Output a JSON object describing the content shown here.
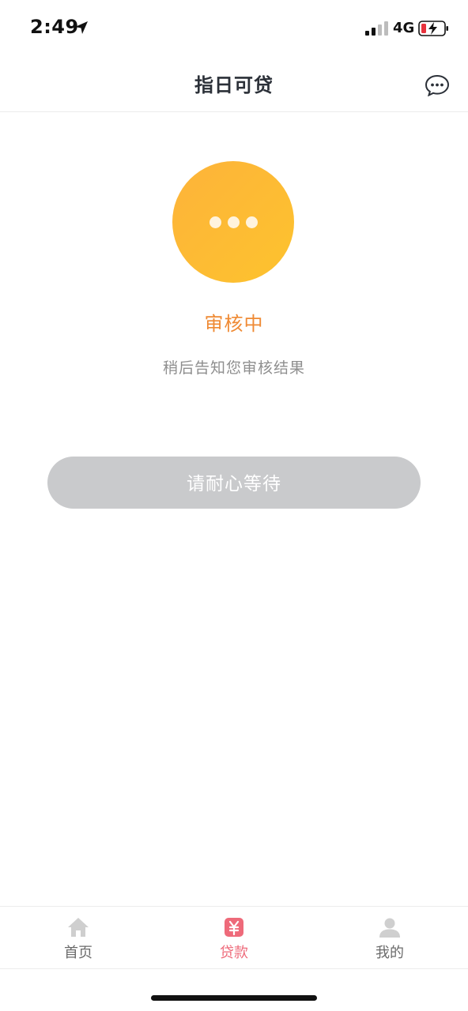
{
  "status_bar": {
    "time": "2:49",
    "network": "4G",
    "icons": [
      "location-arrow-icon",
      "signal-icon",
      "battery-charging-icon"
    ]
  },
  "nav": {
    "title": "指日可贷",
    "chat_icon": "chat-bubble-icon"
  },
  "review": {
    "icon": "pending-dots-icon",
    "title": "审核中",
    "description": "稍后告知您审核结果",
    "button_label": "请耐心等待"
  },
  "tabs": [
    {
      "label": "首页",
      "icon": "home-icon",
      "active": false
    },
    {
      "label": "贷款",
      "icon": "yen-icon",
      "active": true
    },
    {
      "label": "我的",
      "icon": "user-icon",
      "active": false
    }
  ],
  "colors": {
    "accent_orange": "#ef8a34",
    "circle_yellow": "#fdbb35",
    "active_tab": "#ee6a7a",
    "inactive_tab": "#cfcfcf",
    "disabled_button": "#c9cacc"
  }
}
